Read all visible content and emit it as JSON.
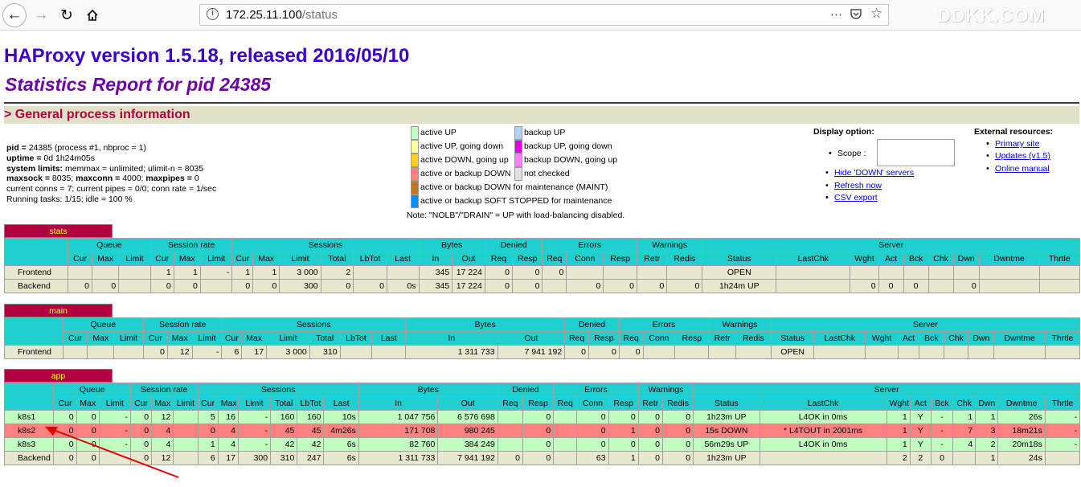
{
  "browser": {
    "url_host": "172.25.11.100",
    "url_path": "/status",
    "watermark": "DDKK.COM"
  },
  "page": {
    "title": "HAProxy version 1.5.18, released 2016/05/10",
    "subtitle": "Statistics Report for pid 24385",
    "section": "> General process information"
  },
  "process_info": {
    "pid_label": "pid = ",
    "pid_value": "24385 (process #1, nbproc = 1)",
    "uptime_label": "uptime = ",
    "uptime_value": "0d 1h24m05s",
    "limits_label": "system limits:",
    "limits_value": " memmax = unlimited; ulimit-n = 8035",
    "maxsock_label": "maxsock = ",
    "maxsock_value": "8035; ",
    "maxconn_label": "maxconn = ",
    "maxconn_value": "4000; ",
    "maxpipes_label": "maxpipes = ",
    "maxpipes_value": "0",
    "conns_line": "current conns = 7; current pipes = 0/0; conn rate = 1/sec",
    "tasks_line": "Running tasks: 1/15; idle = 100 %"
  },
  "legend": [
    {
      "color": "#c0ffc0",
      "label": "active UP"
    },
    {
      "color": "#ffffa0",
      "label": "active UP, going down"
    },
    {
      "color": "#ffd020",
      "label": "active DOWN, going up"
    },
    {
      "color": "#ff8080",
      "label": "active or backup DOWN"
    },
    {
      "color": "#c07820",
      "label": "active or backup DOWN for maintenance (MAINT)"
    },
    {
      "color": "#0090ff",
      "label": "active or backup SOFT STOPPED for maintenance"
    },
    {
      "color": "#b0d0ff",
      "label": "backup UP"
    },
    {
      "color": "#e000e0",
      "label": "backup UP, going down"
    },
    {
      "color": "#ff80ff",
      "label": "backup DOWN, going up"
    },
    {
      "color": "#e0e0e0",
      "label": "not checked"
    }
  ],
  "legend_note": "Note: \"NOLB\"/\"DRAIN\" = UP with load-balancing disabled.",
  "display_options": {
    "title": "Display option:",
    "scope_label": "Scope :",
    "links": [
      "Hide 'DOWN' servers",
      "Refresh now",
      "CSV export"
    ]
  },
  "external_resources": {
    "title": "External resources:",
    "links": [
      "Primary site",
      "Updates (v1.5)",
      "Online manual"
    ]
  },
  "headers": {
    "group": [
      "Queue",
      "Session rate",
      "Sessions",
      "Bytes",
      "Denied",
      "Errors",
      "Warnings",
      "Server"
    ],
    "cols": [
      "Cur",
      "Max",
      "Limit",
      "Cur",
      "Max",
      "Limit",
      "Cur",
      "Max",
      "Limit",
      "Total",
      "LbTot",
      "Last",
      "In",
      "Out",
      "Req",
      "Resp",
      "Req",
      "Conn",
      "Resp",
      "Retr",
      "Redis",
      "Status",
      "LastChk",
      "Wght",
      "Act",
      "Bck",
      "Chk",
      "Dwn",
      "Dwntme",
      "Thrtle"
    ]
  },
  "proxies": [
    {
      "name": "stats",
      "rows": [
        {
          "type": "fe",
          "cells": [
            "Frontend",
            "",
            "",
            "",
            "1",
            "1",
            "-",
            "1",
            "1",
            "3 000",
            "2",
            "",
            "",
            "345",
            "17 224",
            "0",
            "0",
            "0",
            "",
            "",
            "",
            "",
            "OPEN",
            "",
            "",
            "",
            "",
            "",
            "",
            "",
            ""
          ]
        },
        {
          "type": "be",
          "cells": [
            "Backend",
            "0",
            "0",
            "",
            "0",
            "0",
            "",
            "0",
            "0",
            "300",
            "0",
            "0",
            "0s",
            "345",
            "17 224",
            "0",
            "0",
            "",
            "0",
            "0",
            "0",
            "0",
            "1h24m UP",
            "",
            "0",
            "0",
            "0",
            "",
            "0",
            "",
            ""
          ]
        }
      ]
    },
    {
      "name": "main",
      "rows": [
        {
          "type": "fe",
          "cells": [
            "Frontend",
            "",
            "",
            "",
            "0",
            "12",
            "-",
            "6",
            "17",
            "3 000",
            "310",
            "",
            "",
            "1 311 733",
            "7 941 192",
            "0",
            "0",
            "0",
            "",
            "",
            "",
            "",
            "OPEN",
            "",
            "",
            "",
            "",
            "",
            "",
            "",
            ""
          ]
        }
      ]
    },
    {
      "name": "app",
      "rows": [
        {
          "type": "up",
          "cells": [
            "k8s1",
            "0",
            "0",
            "-",
            "0",
            "12",
            "",
            "5",
            "16",
            "-",
            "160",
            "160",
            "10s",
            "1 047 756",
            "6 576 698",
            "",
            "0",
            "",
            "0",
            "0",
            "0",
            "0",
            "1h23m UP",
            "L4OK in 0ms",
            "1",
            "Y",
            "-",
            "1",
            "1",
            "26s",
            "-"
          ]
        },
        {
          "type": "down",
          "cells": [
            "k8s2",
            "0",
            "0",
            "-",
            "0",
            "4",
            "",
            "0",
            "4",
            "-",
            "45",
            "45",
            "4m26s",
            "171 708",
            "980 245",
            "",
            "0",
            "",
            "0",
            "1",
            "0",
            "0",
            "15s DOWN",
            "* L4TOUT in 2001ms",
            "1",
            "Y",
            "-",
            "7",
            "3",
            "18m21s",
            "-"
          ]
        },
        {
          "type": "up",
          "cells": [
            "k8s3",
            "0",
            "0",
            "-",
            "0",
            "4",
            "",
            "1",
            "4",
            "-",
            "42",
            "42",
            "6s",
            "82 760",
            "384 249",
            "",
            "0",
            "",
            "0",
            "0",
            "0",
            "0",
            "56m29s UP",
            "L4OK in 0ms",
            "1",
            "Y",
            "-",
            "4",
            "2",
            "20m18s",
            "-"
          ]
        },
        {
          "type": "be",
          "cells": [
            "Backend",
            "0",
            "0",
            "",
            "0",
            "12",
            "",
            "6",
            "17",
            "300",
            "310",
            "247",
            "6s",
            "1 311 733",
            "7 941 192",
            "0",
            "0",
            "",
            "63",
            "1",
            "0",
            "0",
            "1h23m UP",
            "",
            "2",
            "2",
            "0",
            "",
            "1",
            "24s",
            ""
          ]
        }
      ]
    }
  ]
}
